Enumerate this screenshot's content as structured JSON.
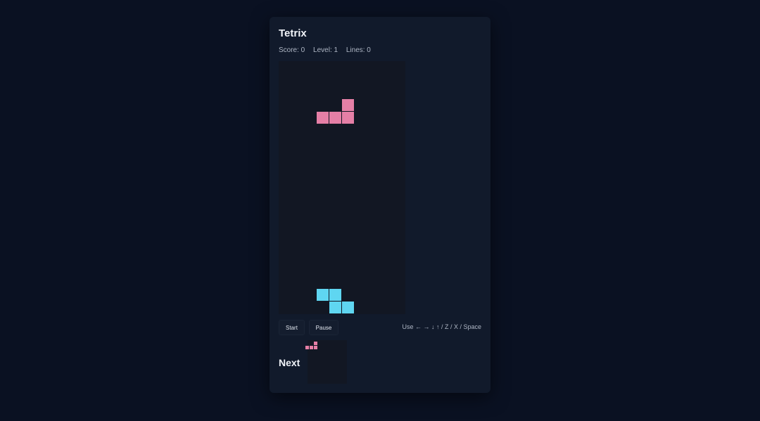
{
  "app": {
    "title": "Tetrix"
  },
  "stats": {
    "score_text": "Score: 0",
    "level_text": "Level: 1",
    "lines_text": "Lines: 0",
    "score": 0,
    "level": 1,
    "lines": 0
  },
  "board": {
    "columns": 10,
    "rows": 20,
    "pieces": [
      {
        "name": "active-piece",
        "shape": "L",
        "color": "#e57fa6",
        "cells": [
          [
            5,
            3
          ],
          [
            3,
            4
          ],
          [
            4,
            4
          ],
          [
            5,
            4
          ]
        ]
      },
      {
        "name": "locked-piece",
        "shape": "Z",
        "color": "#5fd6f1",
        "cells": [
          [
            3,
            18
          ],
          [
            4,
            18
          ],
          [
            4,
            19
          ],
          [
            5,
            19
          ]
        ]
      }
    ]
  },
  "controls": {
    "start_label": "Start",
    "pause_label": "Pause",
    "hint": "Use ← → ↓ ↑ / Z / X / Space"
  },
  "next": {
    "label": "Next",
    "piece": {
      "shape": "L",
      "color": "#e57fa6",
      "cells": [
        [
          2,
          0
        ],
        [
          0,
          1
        ],
        [
          1,
          1
        ],
        [
          2,
          1
        ]
      ]
    }
  },
  "colors": {
    "background": "#0a1122",
    "panel": "#111a2b",
    "board": "#121723",
    "pink_piece": "#e57fa6",
    "cyan_piece": "#5fd6f1"
  }
}
